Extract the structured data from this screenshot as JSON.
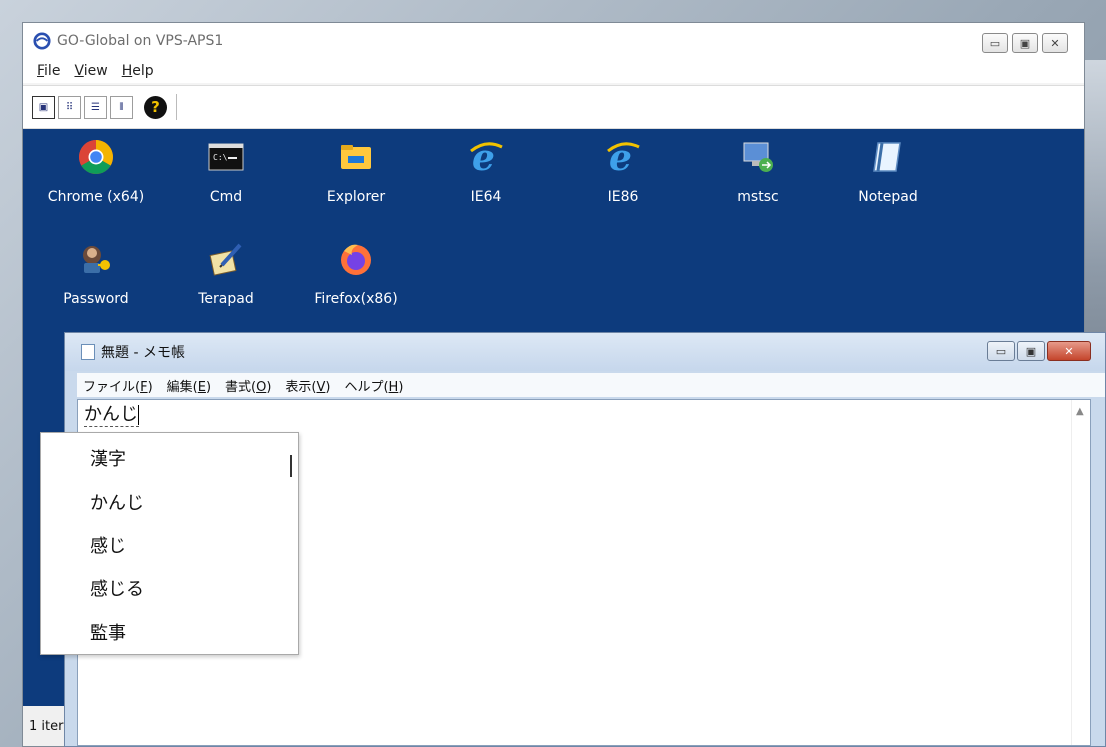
{
  "gg": {
    "title": "GO-Global on VPS-APS1",
    "menu": [
      {
        "label_underlined": "F",
        "label_rest": "ile"
      },
      {
        "label_underlined": "V",
        "label_rest": "iew"
      },
      {
        "label_underlined": "H",
        "label_rest": "elp"
      }
    ],
    "apps": [
      {
        "label": "Chrome (x64)"
      },
      {
        "label": "Cmd"
      },
      {
        "label": "Explorer"
      },
      {
        "label": "IE64"
      },
      {
        "label": "IE86"
      },
      {
        "label": "mstsc"
      },
      {
        "label": "Notepad"
      },
      {
        "label": "Password"
      },
      {
        "label": "Terapad"
      },
      {
        "label": "Firefox(x86)"
      }
    ],
    "status": "1 iter"
  },
  "np": {
    "title": "無題 - メモ帳",
    "menu": [
      {
        "pre": "ファイル(",
        "u": "F",
        "post": ")"
      },
      {
        "pre": "編集(",
        "u": "E",
        "post": ")"
      },
      {
        "pre": "書式(",
        "u": "O",
        "post": ")"
      },
      {
        "pre": "表示(",
        "u": "V",
        "post": ")"
      },
      {
        "pre": "ヘルプ(",
        "u": "H",
        "post": ")"
      }
    ],
    "text": "かんじ"
  },
  "ime": {
    "candidates": [
      "漢字",
      "かんじ",
      "感じ",
      "感じる",
      "監事"
    ]
  }
}
